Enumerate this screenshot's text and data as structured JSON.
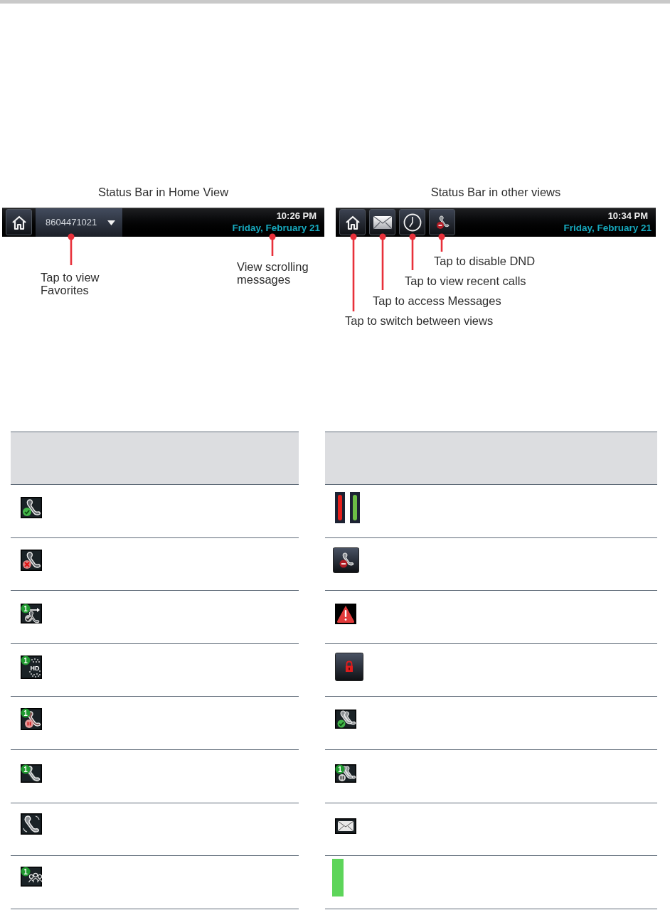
{
  "status_bars": [
    {
      "caption": "Status Bar in Home View",
      "buttons": [
        {
          "kind": "home"
        }
      ],
      "line": "8604471021",
      "time": "10:26 PM",
      "date": "Friday, February 21",
      "callouts": [
        "Tap to view Favorites",
        "View scrolling messages"
      ]
    },
    {
      "caption": "Status Bar in other views",
      "buttons": [
        {
          "kind": "home"
        },
        {
          "kind": "messages"
        },
        {
          "kind": "recent"
        },
        {
          "kind": "dnd"
        }
      ],
      "time": "10:34 PM",
      "date": "Friday, February 21",
      "callouts": [
        "Tap to disable DND",
        "Tap to view recent calls",
        "Tap to access Messages",
        "Tap to switch between views"
      ]
    }
  ],
  "icon_tables": [
    {
      "rows": [
        {
          "kind": "registered"
        },
        {
          "kind": "unregistered"
        },
        {
          "kind": "forward",
          "badge": "1"
        },
        {
          "kind": "hd",
          "badge": "1",
          "label": "HD"
        },
        {
          "kind": "hold",
          "badge": "1"
        },
        {
          "kind": "active",
          "badge": "1"
        },
        {
          "kind": "ringing"
        },
        {
          "kind": "conference",
          "badge": "1"
        }
      ]
    },
    {
      "rows": [
        {
          "kind": "indicators",
          "bars": [
            {
              "color": "#e5201c"
            },
            {
              "color": "#6cbe45"
            }
          ]
        },
        {
          "kind": "dnd"
        },
        {
          "kind": "alert"
        },
        {
          "kind": "lock"
        },
        {
          "kind": "shared"
        },
        {
          "kind": "shared-hold",
          "badge": "1"
        },
        {
          "kind": "message"
        },
        {
          "kind": "bar",
          "color": "#5dd55a"
        }
      ]
    }
  ]
}
